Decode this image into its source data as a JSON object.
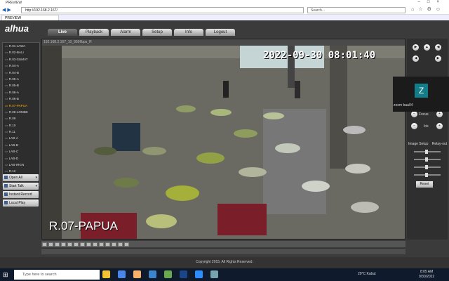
{
  "browser": {
    "window_title": "PREVIEW",
    "url": "http://192.168.2.167/",
    "search_placeholder": "Search...",
    "tab_title": "PREVIEW"
  },
  "app": {
    "logo": "alhua",
    "menu": [
      "Live",
      "Playback",
      "Alarm",
      "Setup",
      "Info",
      "Logout"
    ],
    "active_menu": "Live"
  },
  "sidebar": {
    "cameras": [
      "R.01-JAWA",
      "R.02-BALI",
      "R.03-SUMAT",
      "R.04-A",
      "R.04-B",
      "R.05-A",
      "R.05-B",
      "R.06-A",
      "R.06-B",
      "R.07-PAPUA",
      "R.08-LOMBK",
      "R.09",
      "R.10",
      "R.11",
      "LAB-A",
      "LAB-B",
      "LAB-C",
      "LAB-D",
      "LAB-IRGN",
      "R.12"
    ],
    "selected": "R.07-PAPUA",
    "buttons": [
      "Open All",
      "Start Talk",
      "Instant Record",
      "Local Play"
    ]
  },
  "video": {
    "header": "192.168.2.167_10_9596bps_R",
    "timestamp": "2022-09-30 08:01:40",
    "camera_name": "R.07-PAPUA"
  },
  "ptz": {
    "focus_label": "Focus",
    "iris_label": "Iris",
    "image_setup_label": "Image Setup",
    "relay_label": "Relay-out",
    "reset_label": "Reset"
  },
  "zoom_overlay": {
    "initial": "Z",
    "name": "zoom baa04"
  },
  "footer": "Copyright 2015, All Rights Reserved.",
  "taskbar": {
    "search_placeholder": "Type here to search",
    "weather": "29°C Kabut",
    "time": "8:05 AM",
    "date": "9/30/2022"
  }
}
